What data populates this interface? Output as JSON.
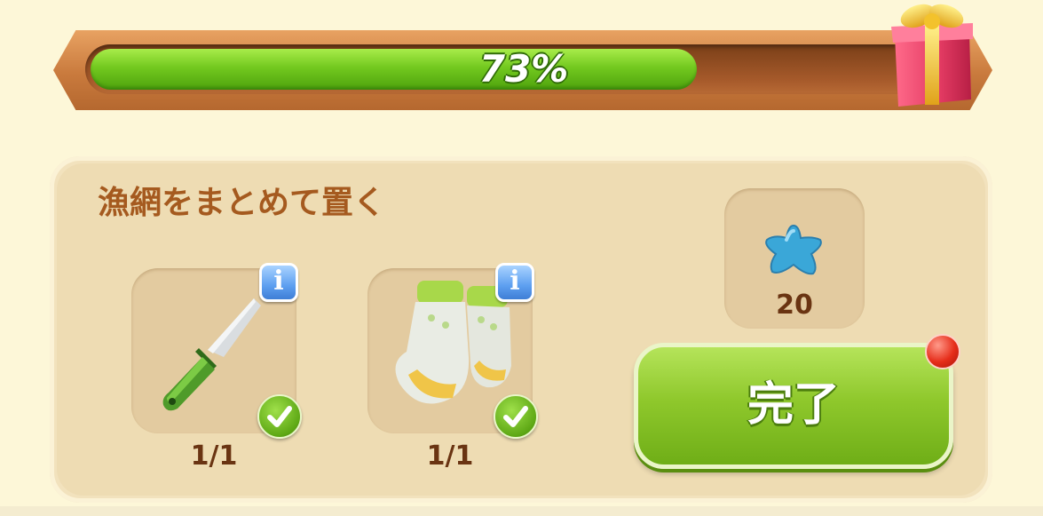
{
  "progress": {
    "percent_label": "73%",
    "fraction": 0.73,
    "fill_color": "#73c91f"
  },
  "gift_icon": "gift-box-icon",
  "task": {
    "title": "漁網をまとめて置く",
    "requirements": [
      {
        "item": "knife-icon",
        "count": "1/1",
        "completed": true
      },
      {
        "item": "gloves-icon",
        "count": "1/1",
        "completed": true
      }
    ],
    "reward": {
      "icon": "blue-star-icon",
      "amount": "20"
    },
    "complete_label": "完了"
  },
  "colors": {
    "accent_green": "#8fc82c",
    "title_brown": "#a55a1f",
    "notification_red": "#e62d1a"
  }
}
